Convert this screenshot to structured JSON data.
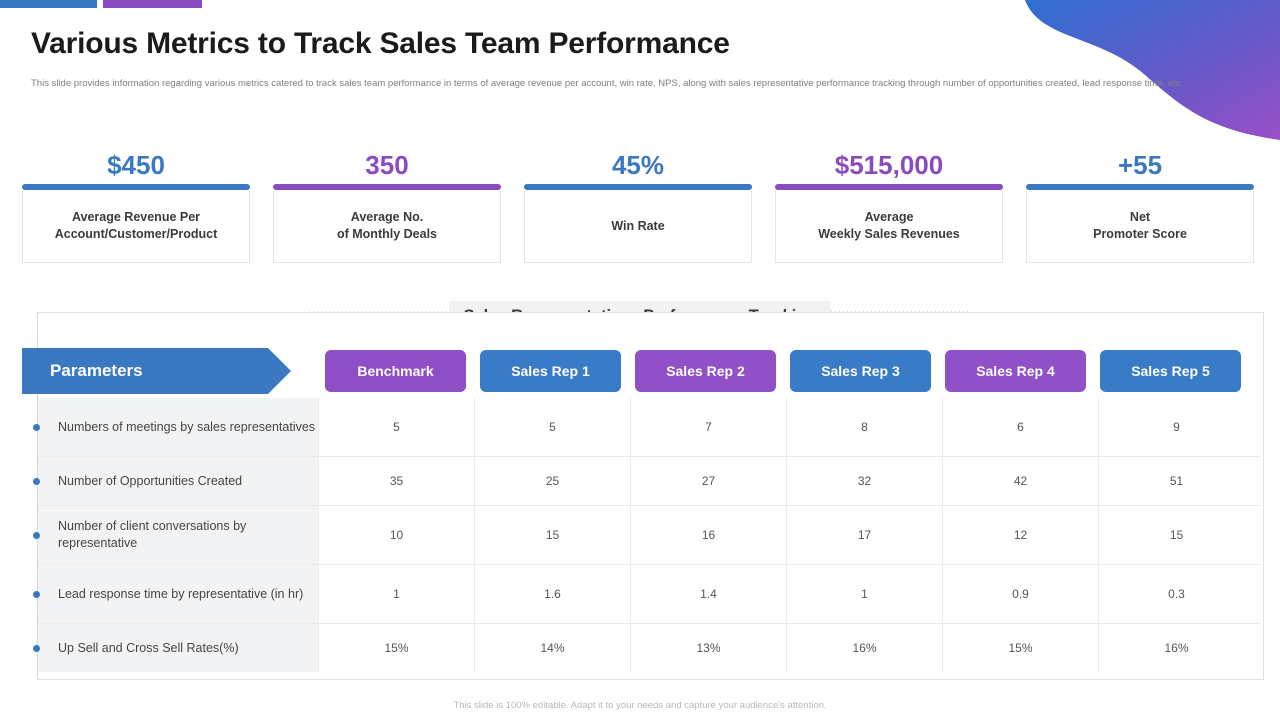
{
  "header": {
    "title": "Various Metrics to Track Sales Team Performance",
    "subtitle": "This slide provides information regarding various metrics catered to track sales team performance in terms of average revenue per account, win rate, NPS, along with sales representative performance tracking through number of opportunities created, lead response time, etc.",
    "accent_blue": "#3a78c2",
    "accent_purple": "#8a4bbf"
  },
  "kpis": [
    {
      "value": "$450",
      "label_line1": "Average Revenue Per",
      "label_line2": "Account/Customer/Product",
      "color": "#3a78c2"
    },
    {
      "value": "350",
      "label_line1": "Average No.",
      "label_line2": "of Monthly Deals",
      "color": "#8a4bbf"
    },
    {
      "value": "45%",
      "label_line1": "Win Rate",
      "label_line2": "",
      "color": "#3a78c2"
    },
    {
      "value": "$515,000",
      "label_line1": "Average",
      "label_line2": "Weekly Sales Revenues",
      "color": "#8a4bbf"
    },
    {
      "value": "+55",
      "label_line1": "Net",
      "label_line2": "Promoter Score",
      "color": "#3a78c2"
    }
  ],
  "section": {
    "title": "Sales Representatives Performance Tracking"
  },
  "table": {
    "parameters_header": "Parameters",
    "columns": [
      {
        "label": "Benchmark",
        "color": "#8e4ec6"
      },
      {
        "label": "Sales Rep 1",
        "color": "#3a7bc8"
      },
      {
        "label": "Sales Rep 2",
        "color": "#9050c8"
      },
      {
        "label": "Sales Rep 3",
        "color": "#3a7bc8"
      },
      {
        "label": "Sales Rep 4",
        "color": "#9050c8"
      },
      {
        "label": "Sales Rep 5",
        "color": "#3a7bc8"
      }
    ],
    "rows": [
      {
        "label": "Numbers of meetings by sales representatives",
        "values": [
          "5",
          "5",
          "7",
          "8",
          "6",
          "9"
        ]
      },
      {
        "label": "Number of Opportunities Created",
        "values": [
          "35",
          "25",
          "27",
          "32",
          "42",
          "51"
        ]
      },
      {
        "label": "Number of client conversations by representative",
        "values": [
          "10",
          "15",
          "16",
          "17",
          "12",
          "15"
        ]
      },
      {
        "label": "Lead response time by representative (in hr)",
        "values": [
          "1",
          "1.6",
          "1.4",
          "1",
          "0.9",
          "0.3"
        ]
      },
      {
        "label": "Up Sell and Cross Sell Rates(%)",
        "values": [
          "15%",
          "14%",
          "13%",
          "16%",
          "15%",
          "16%"
        ]
      }
    ]
  },
  "footer": {
    "note": "This slide is 100% editable. Adapt it to your needs and capture your audience's attention."
  }
}
